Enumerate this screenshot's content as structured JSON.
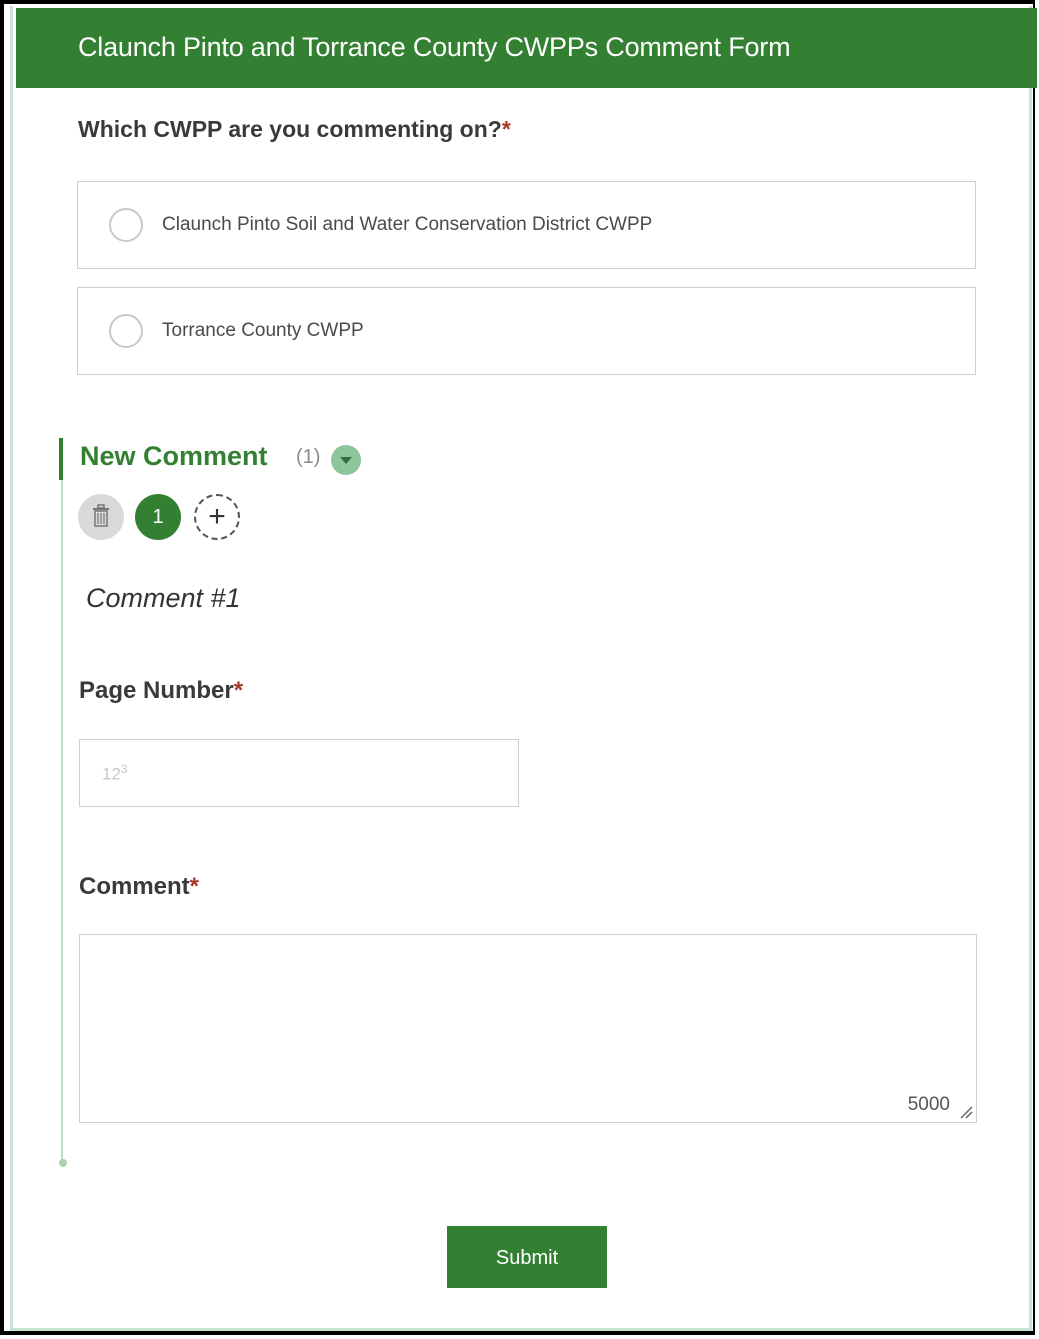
{
  "form": {
    "title": "Claunch Pinto and Torrance County CWPPs Comment Form"
  },
  "question": {
    "text": "Which CWPP are you commenting on?",
    "required_mark": "*",
    "options": [
      "Claunch Pinto Soil and Water Conservation District CWPP",
      "Torrance County CWPP"
    ]
  },
  "repeat_group": {
    "title": "New Comment",
    "count": "(1)",
    "current_page": "1",
    "entry_heading": "Comment #1"
  },
  "fields": {
    "page_number": {
      "label": "Page Number",
      "required_mark": "*",
      "value": "",
      "icon": "numeric-input-icon",
      "icon_text": "12",
      "icon_sup": "3"
    },
    "comment": {
      "label": "Comment",
      "required_mark": "*",
      "value": "",
      "char_limit": "5000"
    }
  },
  "actions": {
    "submit_label": "Submit"
  },
  "colors": {
    "brand_green": "#338033",
    "required_red": "#a63a2a",
    "light_green": "#8fc59a"
  }
}
